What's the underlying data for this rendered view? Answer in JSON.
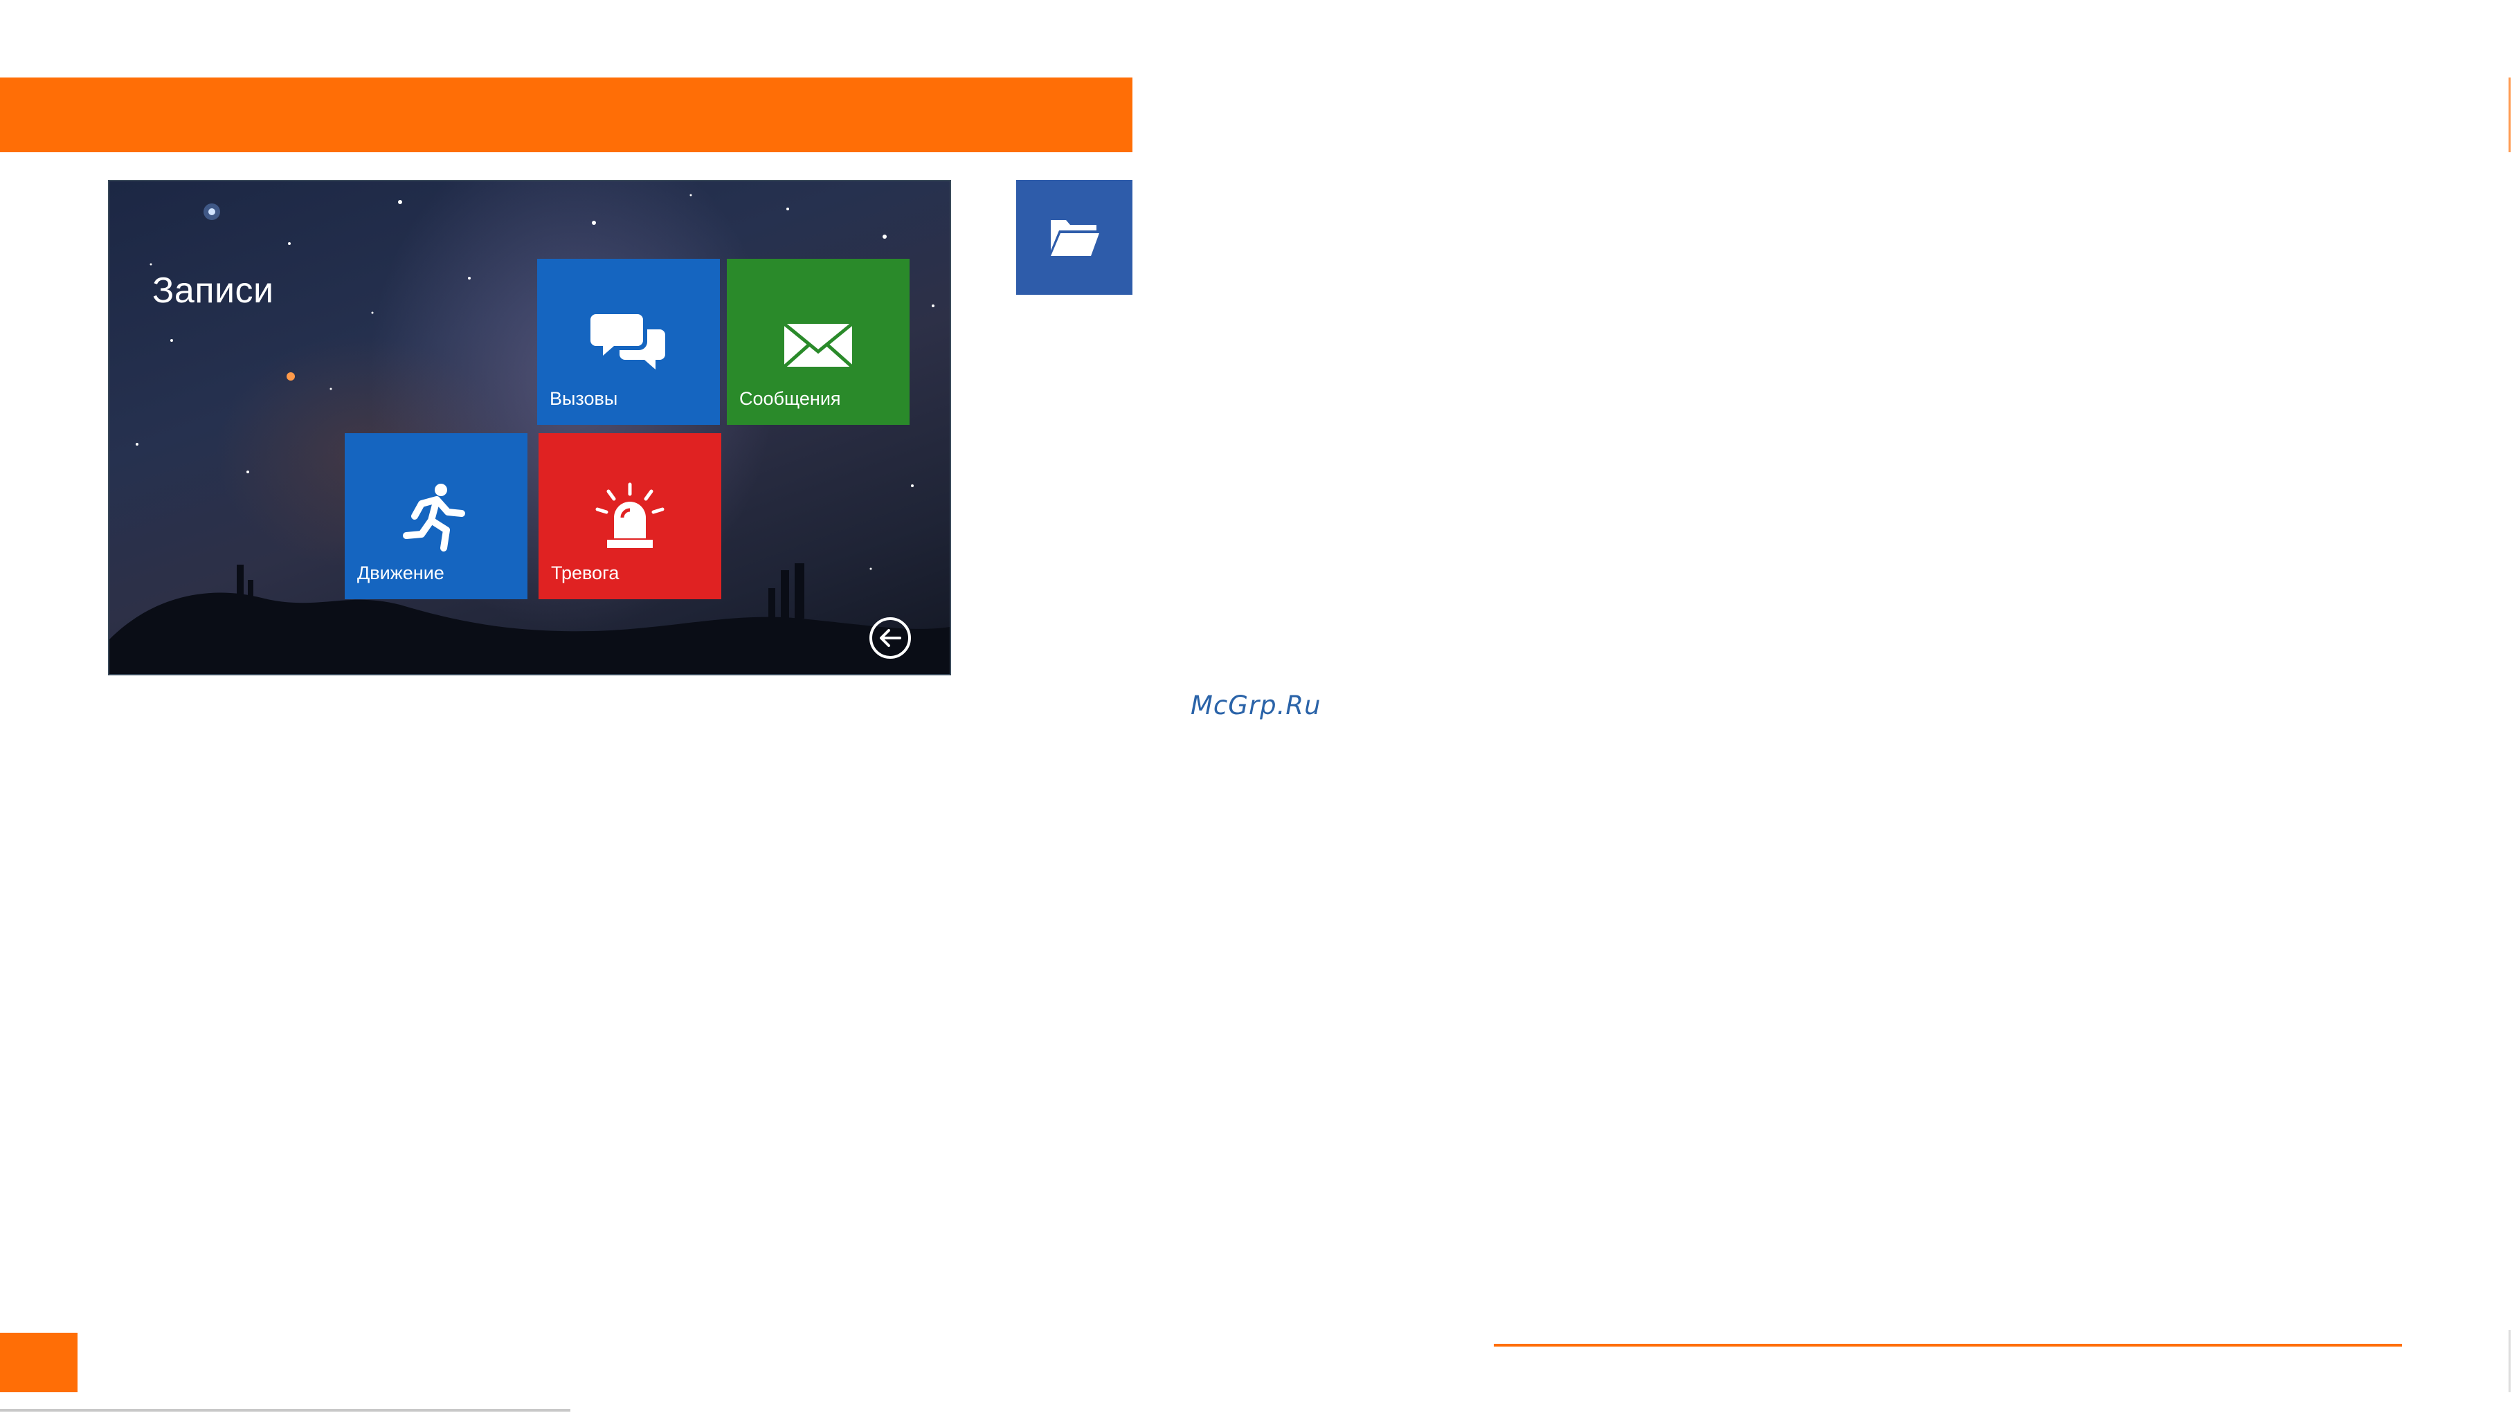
{
  "screen": {
    "title": "Записи",
    "tiles": [
      {
        "label": "Вызовы",
        "icon": "chat-bubbles-icon",
        "color": "#1565c0"
      },
      {
        "label": "Сообщения",
        "icon": "envelope-icon",
        "color": "#2a8a2a"
      },
      {
        "label": "Движение",
        "icon": "running-man-icon",
        "color": "#1565c0"
      },
      {
        "label": "Тревога",
        "icon": "siren-icon",
        "color": "#e02222"
      }
    ],
    "back_icon": "back-arrow-icon"
  },
  "side_icon": {
    "icon": "open-folder-icon",
    "color": "#2e5caa"
  },
  "watermark": "McGrp.Ru",
  "accent_color": "#ff6e06"
}
